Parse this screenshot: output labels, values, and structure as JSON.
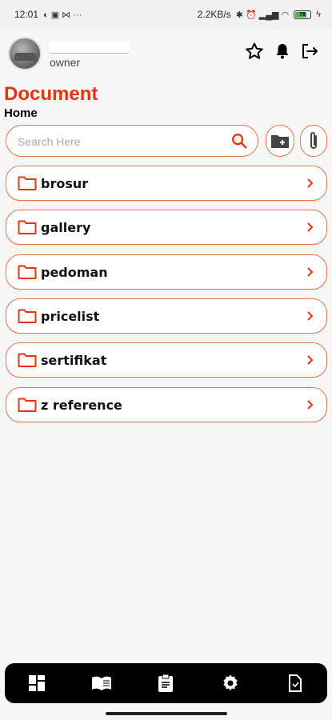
{
  "status_bar": {
    "time": "12:01",
    "speed": "2.2KB/s",
    "battery": "78"
  },
  "header": {
    "role": "owner"
  },
  "page": {
    "title": "Document",
    "breadcrumb": "Home"
  },
  "search": {
    "placeholder": "Search Here",
    "value": ""
  },
  "folders": [
    {
      "label": "brosur"
    },
    {
      "label": "gallery"
    },
    {
      "label": "pedoman"
    },
    {
      "label": "pricelist"
    },
    {
      "label": "sertifikat"
    },
    {
      "label": "z reference"
    }
  ],
  "colors": {
    "accent": "#e8340c",
    "border": "#e8744a",
    "nav_bg": "#000000"
  },
  "icons": {
    "header": [
      "star-icon",
      "bell-icon",
      "logout-icon"
    ],
    "toolbar": [
      "search-icon",
      "add-folder-icon",
      "attach-icon"
    ],
    "bottom_nav": [
      "dashboard-icon",
      "book-icon",
      "clipboard-icon",
      "gear-icon",
      "document-icon"
    ]
  }
}
